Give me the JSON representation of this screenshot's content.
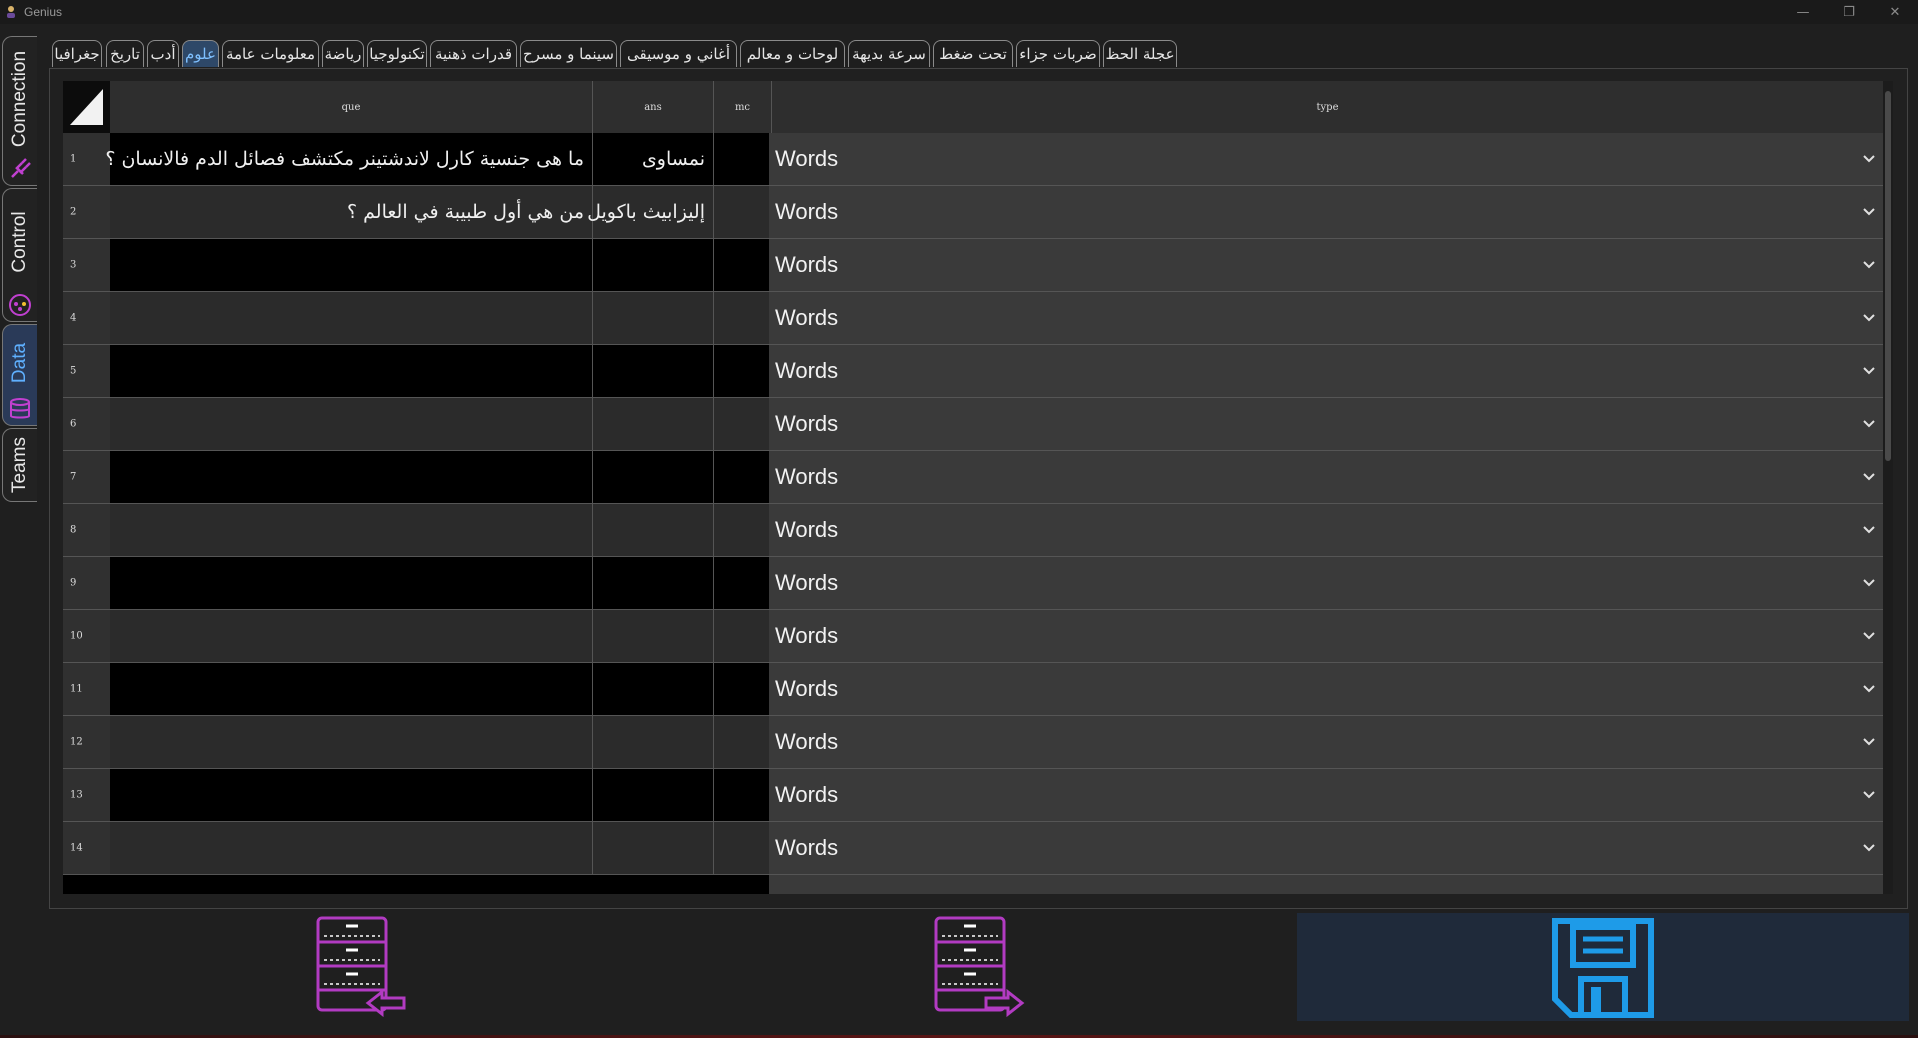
{
  "window": {
    "title": "Genius",
    "controls": [
      "minimize",
      "restore",
      "close"
    ]
  },
  "side_tabs": [
    {
      "label": "Connection",
      "icon": "plug-icon",
      "active": false
    },
    {
      "label": "Control",
      "icon": "gamepad-icon",
      "active": false
    },
    {
      "label": "Data",
      "icon": "database-icon",
      "active": true
    },
    {
      "label": "Teams",
      "icon": "team-icon",
      "active": false
    }
  ],
  "categories": [
    {
      "label": "جغرافيا",
      "active": false
    },
    {
      "label": "تاريخ",
      "active": false
    },
    {
      "label": "أدب",
      "active": false
    },
    {
      "label": "علوم",
      "active": true
    },
    {
      "label": "معلومات عامة",
      "active": false
    },
    {
      "label": "رياضة",
      "active": false
    },
    {
      "label": "تكنولوجيا",
      "active": false
    },
    {
      "label": "قدرات ذهنية",
      "active": false
    },
    {
      "label": "سينما و مسرح",
      "active": false
    },
    {
      "label": "أغاني و موسيقى",
      "active": false
    },
    {
      "label": "لوحات و معالم",
      "active": false
    },
    {
      "label": "سرعة بديهة",
      "active": false
    },
    {
      "label": "تحت ضغط",
      "active": false
    },
    {
      "label": "ضربات جزاء",
      "active": false
    },
    {
      "label": "عجلة الحظ",
      "active": false
    }
  ],
  "table": {
    "columns": [
      "que",
      "ans",
      "mc",
      "type"
    ],
    "rows": [
      {
        "num": "1",
        "que": "ما هى جنسية كارل لاندشتينر مكتشف فصائل الدم فالانسان ؟",
        "ans": "نمساوى",
        "mc": "",
        "type": "Words"
      },
      {
        "num": "2",
        "que": "من هي أول طبيبة في العالم ؟",
        "ans": "إليزابيث باكويل",
        "mc": "",
        "type": "Words"
      },
      {
        "num": "3",
        "que": "",
        "ans": "",
        "mc": "",
        "type": "Words"
      },
      {
        "num": "4",
        "que": "",
        "ans": "",
        "mc": "",
        "type": "Words"
      },
      {
        "num": "5",
        "que": "",
        "ans": "",
        "mc": "",
        "type": "Words"
      },
      {
        "num": "6",
        "que": "",
        "ans": "",
        "mc": "",
        "type": "Words"
      },
      {
        "num": "7",
        "que": "",
        "ans": "",
        "mc": "",
        "type": "Words"
      },
      {
        "num": "8",
        "que": "",
        "ans": "",
        "mc": "",
        "type": "Words"
      },
      {
        "num": "9",
        "que": "",
        "ans": "",
        "mc": "",
        "type": "Words"
      },
      {
        "num": "10",
        "que": "",
        "ans": "",
        "mc": "",
        "type": "Words"
      },
      {
        "num": "11",
        "que": "",
        "ans": "",
        "mc": "",
        "type": "Words"
      },
      {
        "num": "12",
        "que": "",
        "ans": "",
        "mc": "",
        "type": "Words"
      },
      {
        "num": "13",
        "que": "",
        "ans": "",
        "mc": "",
        "type": "Words"
      },
      {
        "num": "14",
        "que": "",
        "ans": "",
        "mc": "",
        "type": "Words"
      }
    ]
  },
  "actions": [
    {
      "name": "import-button",
      "icon": "import-database-icon"
    },
    {
      "name": "export-button",
      "icon": "export-database-icon"
    },
    {
      "name": "save-button",
      "icon": "save-icon"
    }
  ],
  "colors": {
    "accent_magenta": "#b23bc2",
    "accent_blue": "#1e9be8",
    "active_tab": "#2e4868"
  }
}
